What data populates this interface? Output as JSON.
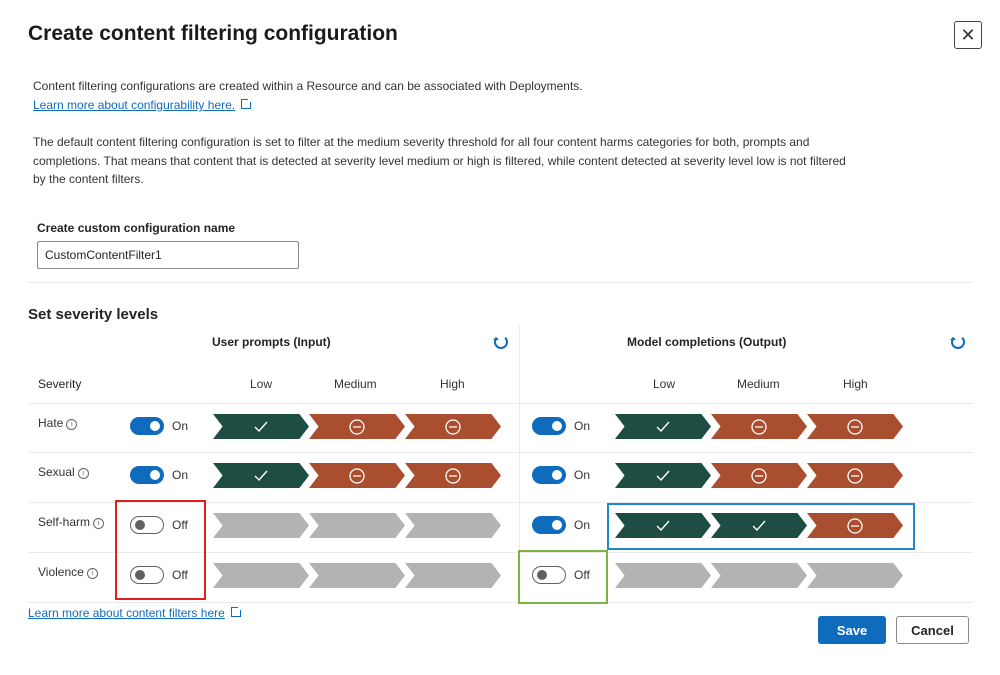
{
  "dialog": {
    "title": "Create content filtering configuration",
    "close_icon": "close-icon"
  },
  "intro": {
    "line1": "Content filtering configurations are created within a Resource and can be associated with Deployments.",
    "link1": "Learn more about configurability here.",
    "description": "The default content filtering configuration is set to filter at the medium severity threshold for all four content harms categories for both, prompts and completions. That means that content that is detected at severity level medium or high is filtered, while content detected at severity level low is not filtered by the content filters."
  },
  "config_name": {
    "label": "Create custom configuration name",
    "value": "CustomContentFilter1"
  },
  "severity": {
    "heading": "Set severity levels",
    "severity_col": "Severity",
    "input_header": "User prompts (Input)",
    "output_header": "Model completions (Output)",
    "levels": [
      "Low",
      "Medium",
      "High"
    ],
    "rows": [
      {
        "name": "Hate",
        "input": {
          "toggle": "On",
          "states": [
            "allow",
            "block",
            "block"
          ]
        },
        "output": {
          "toggle": "On",
          "states": [
            "allow",
            "block",
            "block"
          ]
        }
      },
      {
        "name": "Sexual",
        "input": {
          "toggle": "On",
          "states": [
            "allow",
            "block",
            "block"
          ]
        },
        "output": {
          "toggle": "On",
          "states": [
            "allow",
            "block",
            "block"
          ]
        }
      },
      {
        "name": "Self-harm",
        "input": {
          "toggle": "Off",
          "states": [
            "off",
            "off",
            "off"
          ]
        },
        "output": {
          "toggle": "On",
          "states": [
            "allow",
            "allow",
            "block"
          ]
        }
      },
      {
        "name": "Violence",
        "input": {
          "toggle": "Off",
          "states": [
            "off",
            "off",
            "off"
          ]
        },
        "output": {
          "toggle": "Off",
          "states": [
            "off",
            "off",
            "off"
          ]
        }
      }
    ]
  },
  "footer": {
    "learn_link": "Learn more about content filters here",
    "save": "Save",
    "cancel": "Cancel"
  },
  "colors": {
    "allow": "#1d4d43",
    "block": "#a94e2e",
    "off": "#b3b3b3",
    "accent": "#0f6cbd",
    "highlight_red": "#e02020",
    "highlight_blue": "#1e88c8",
    "highlight_green": "#7cb342"
  }
}
